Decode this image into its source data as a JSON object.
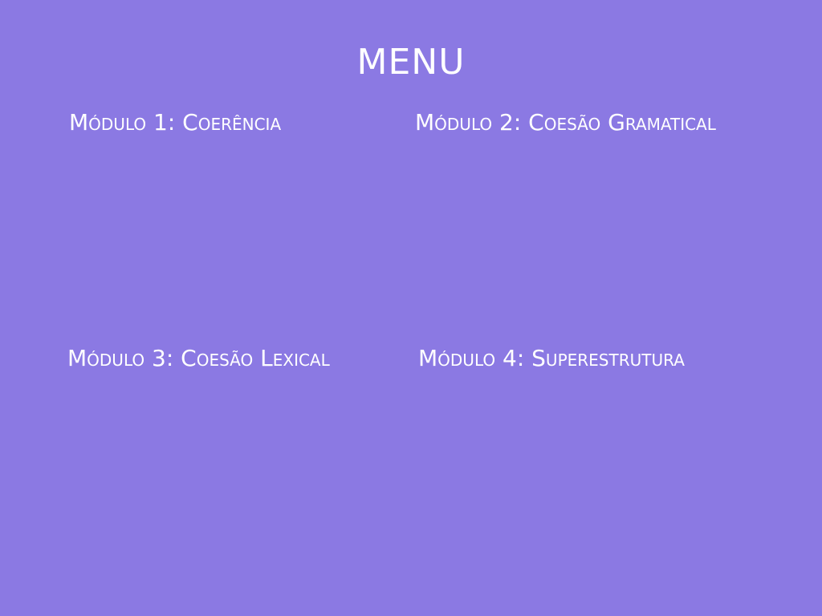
{
  "colors": {
    "background": "#8b79e3",
    "text": "#ffffff"
  },
  "menu": {
    "title": "MENU",
    "modules": [
      {
        "label": "Módulo 1: Coerência"
      },
      {
        "label": "Módulo 2: Coesão Gramatical"
      },
      {
        "label": "Módulo 3: Coesão Lexical"
      },
      {
        "label": "Módulo 4: Superestrutura"
      }
    ]
  }
}
